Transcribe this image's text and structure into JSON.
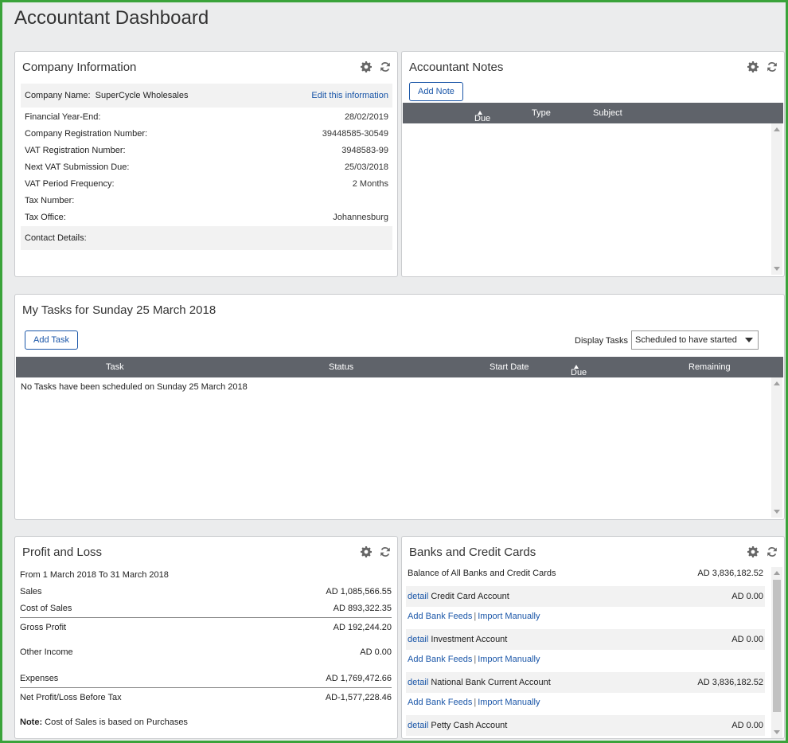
{
  "page": {
    "title": "Accountant Dashboard"
  },
  "company_info": {
    "title": "Company Information",
    "company_name_label": "Company Name:",
    "company_name": "SuperCycle Wholesales",
    "edit_link": "Edit this information",
    "rows": [
      {
        "label": "Financial Year-End:",
        "value": "28/02/2019"
      },
      {
        "label": "Company Registration Number:",
        "value": "39448585-30549"
      },
      {
        "label": "VAT Registration Number:",
        "value": "3948583-99"
      },
      {
        "label": "Next VAT Submission Due:",
        "value": "25/03/2018"
      },
      {
        "label": "VAT Period Frequency:",
        "value": "2 Months"
      },
      {
        "label": "Tax Number:",
        "value": ""
      },
      {
        "label": "Tax Office:",
        "value": "Johannesburg"
      }
    ],
    "contact_label": "Contact Details:"
  },
  "notes": {
    "title": "Accountant Notes",
    "add_button": "Add Note",
    "columns": [
      "Due Date",
      "Type",
      "Subject"
    ]
  },
  "tasks": {
    "title": "My Tasks for Sunday 25 March 2018",
    "add_button": "Add Task",
    "display_label": "Display Tasks",
    "display_value": "Scheduled to have started",
    "columns": [
      "Task",
      "Status",
      "Start Date",
      "Due Date",
      "Remaining"
    ],
    "empty_message": "No Tasks have been scheduled on Sunday 25 March 2018"
  },
  "pnl": {
    "title": "Profit and Loss",
    "period": "From 1 March 2018 To 31 March 2018",
    "sales_label": "Sales",
    "sales": "AD 1,085,566.55",
    "cos_label": "Cost of Sales",
    "cos": "AD 893,322.35",
    "gross_label": "Gross Profit",
    "gross": "AD 192,244.20",
    "other_label": "Other Income",
    "other": "AD 0.00",
    "expenses_label": "Expenses",
    "expenses": "AD 1,769,472.66",
    "net_label": "Net Profit/Loss Before Tax",
    "net": "AD-1,577,228.46",
    "note_label": "Note:",
    "note_text": " Cost of Sales is based on Purchases"
  },
  "banks": {
    "title": "Banks and Credit Cards",
    "balance_label": "Balance of All Banks and Credit Cards",
    "balance": "AD 3,836,182.52",
    "detail_link": "detail",
    "feeds_link": "Add Bank Feeds",
    "import_link": "Import Manually",
    "separator": "|",
    "accounts": [
      {
        "name": "Credit Card Account",
        "balance": "AD 0.00"
      },
      {
        "name": "Investment Account",
        "balance": "AD 0.00"
      },
      {
        "name": "National Bank Current Account",
        "balance": "AD 3,836,182.52"
      },
      {
        "name": "Petty Cash Account",
        "balance": "AD 0.00"
      }
    ]
  },
  "colors": {
    "accent": "#1a56a8",
    "frame": "#3aa33a",
    "grid_header": "#5f636a"
  },
  "icons": {
    "settings": "gear-icon",
    "refresh": "refresh-icon"
  }
}
